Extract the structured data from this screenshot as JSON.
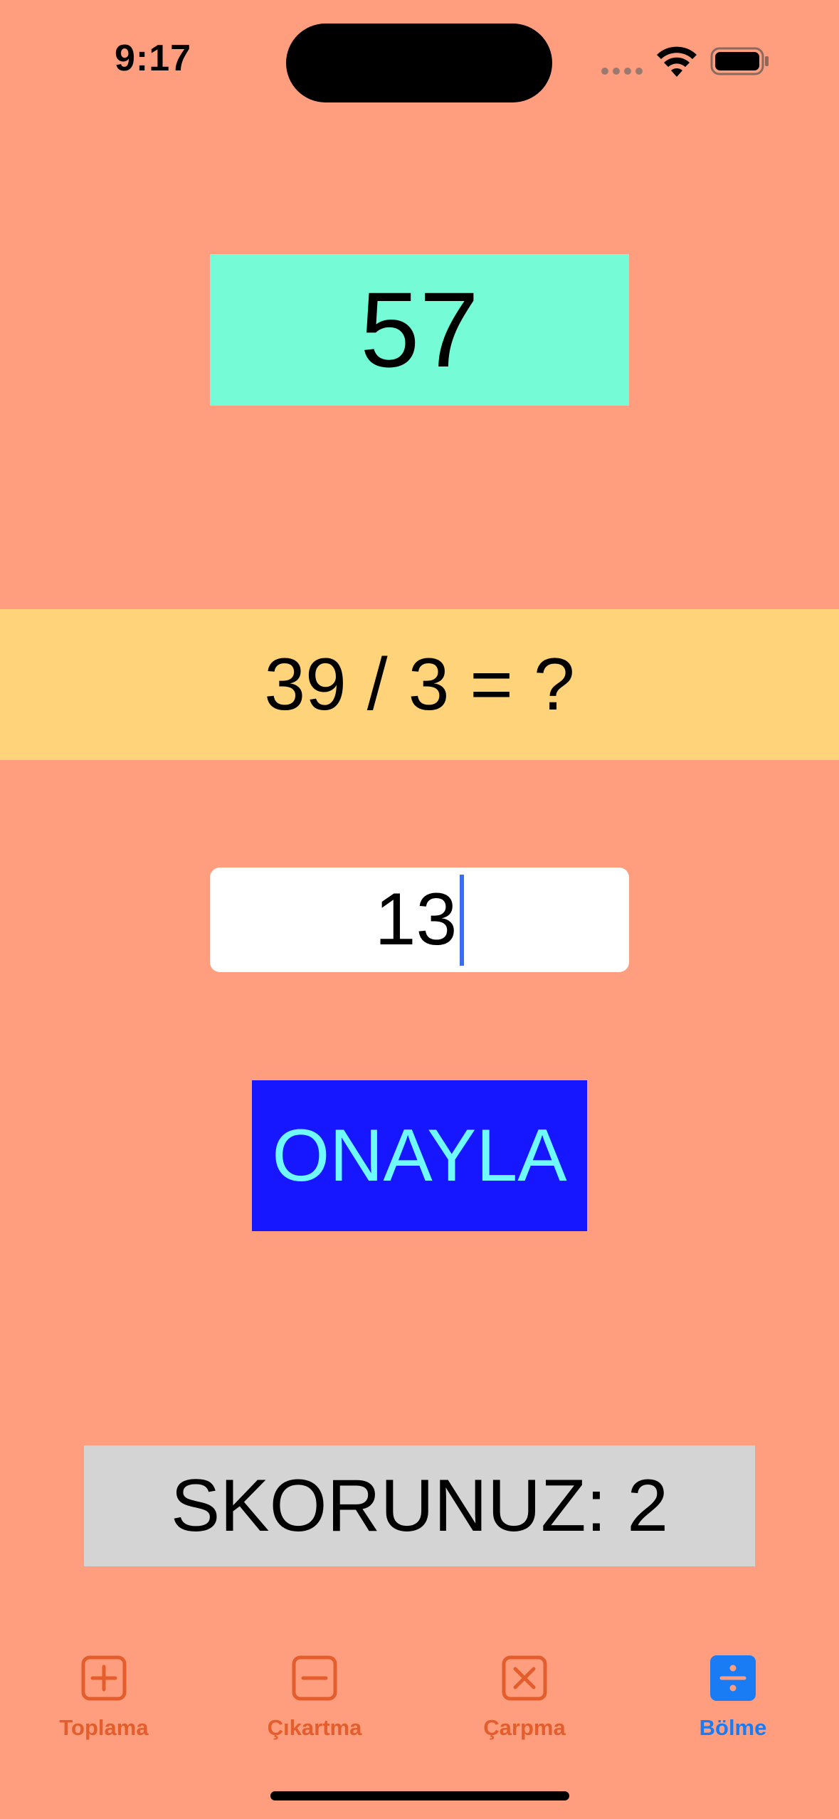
{
  "status_bar": {
    "time": "9:17"
  },
  "game": {
    "target_number": "57",
    "question": "39 / 3 = ?",
    "answer_value": "13",
    "confirm_label": "ONAYLA",
    "score_text": "SKORUNUZ: 2"
  },
  "tabs": [
    {
      "label": "Toplama",
      "icon": "plus-square-icon",
      "selected": false
    },
    {
      "label": "Çıkartma",
      "icon": "minus-square-icon",
      "selected": false
    },
    {
      "label": "Çarpma",
      "icon": "multiply-square-icon",
      "selected": false
    },
    {
      "label": "Bölme",
      "icon": "divide-square-icon",
      "selected": true
    }
  ],
  "colors": {
    "background": "#FF9E7E",
    "target_box": "#75FCD6",
    "question_band": "#FFD37A",
    "answer_field": "#FFFFFF",
    "confirm_button": "#1717FF",
    "confirm_text": "#6FF9FB",
    "score_box": "#D4D4D4",
    "tab_inactive": "#E35E2C",
    "tab_active": "#1A7CF5"
  }
}
